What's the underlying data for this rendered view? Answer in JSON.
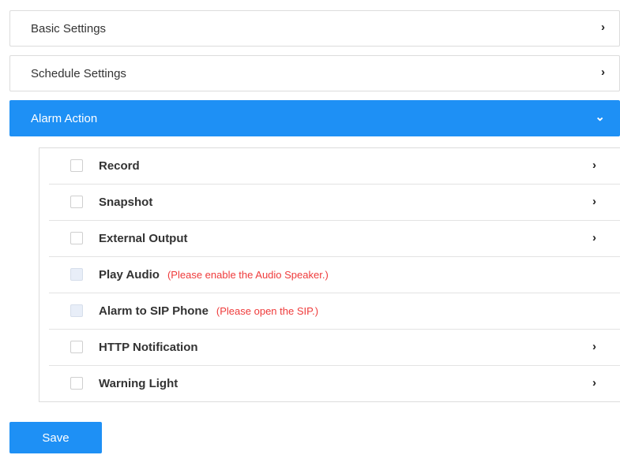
{
  "sections": {
    "basic": {
      "label": "Basic Settings",
      "chevron": "›"
    },
    "schedule": {
      "label": "Schedule Settings",
      "chevron": "›"
    },
    "alarm_action": {
      "label": "Alarm Action",
      "chevron": "⌄",
      "expanded": true
    }
  },
  "actions": [
    {
      "label": "Record",
      "note": "",
      "chevron": "›",
      "checked": false,
      "enabled": true
    },
    {
      "label": "Snapshot",
      "note": "",
      "chevron": "›",
      "checked": false,
      "enabled": true
    },
    {
      "label": "External Output",
      "note": "",
      "chevron": "›",
      "checked": false,
      "enabled": true
    },
    {
      "label": "Play Audio",
      "note": "(Please enable the Audio Speaker.)",
      "chevron": "",
      "checked": false,
      "enabled": false
    },
    {
      "label": "Alarm to SIP Phone",
      "note": "(Please open the SIP.)",
      "chevron": "",
      "checked": false,
      "enabled": false
    },
    {
      "label": "HTTP Notification",
      "note": "",
      "chevron": "›",
      "checked": false,
      "enabled": true
    },
    {
      "label": "Warning Light",
      "note": "",
      "chevron": "›",
      "checked": false,
      "enabled": true
    }
  ],
  "save_label": "Save",
  "colors": {
    "accent": "#1e90f5",
    "warning_text": "#ef3b3b",
    "border": "#dcdcdc"
  }
}
